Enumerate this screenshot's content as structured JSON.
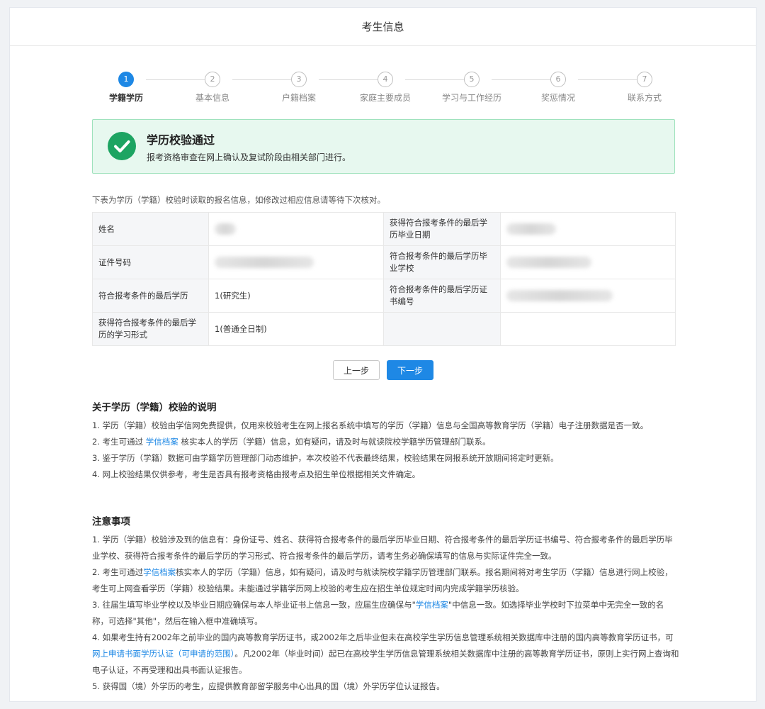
{
  "page": {
    "title": "考生信息"
  },
  "steps": [
    {
      "num": "1",
      "label": "学籍学历"
    },
    {
      "num": "2",
      "label": "基本信息"
    },
    {
      "num": "3",
      "label": "户籍档案"
    },
    {
      "num": "4",
      "label": "家庭主要成员"
    },
    {
      "num": "5",
      "label": "学习与工作经历"
    },
    {
      "num": "6",
      "label": "奖惩情况"
    },
    {
      "num": "7",
      "label": "联系方式"
    }
  ],
  "alert": {
    "title": "学历校验通过",
    "subtitle": "报考资格审查在网上确认及复试阶段由相关部门进行。"
  },
  "intro": "下表为学历（学籍）校验时读取的报名信息，如修改过相应信息请等待下次核对。",
  "table": {
    "rows": [
      {
        "l1": "姓名",
        "v1": "",
        "l2": "获得符合报考条件的最后学历毕业日期",
        "v2": ""
      },
      {
        "l1": "证件号码",
        "v1": "",
        "l2": "符合报考条件的最后学历毕业学校",
        "v2": ""
      },
      {
        "l1": "符合报考条件的最后学历",
        "v1": "1(研究生)",
        "l2": "符合报考条件的最后学历证书编号",
        "v2": ""
      },
      {
        "l1": "获得符合报考条件的最后学历的学习形式",
        "v1": "1(普通全日制)",
        "l2": "",
        "v2": ""
      }
    ]
  },
  "buttons": {
    "prev": "上一步",
    "next": "下一步"
  },
  "about": {
    "title": "关于学历（学籍）校验的说明",
    "p1": "1. 学历（学籍）校验由学信网免费提供，仅用来校验考生在网上报名系统中填写的学历（学籍）信息与全国高等教育学历（学籍）电子注册数据是否一致。",
    "p2_a": "2. 考生可通过 ",
    "p2_link": "学信档案",
    "p2_b": " 核实本人的学历（学籍）信息，如有疑问，请及时与就读院校学籍学历管理部门联系。",
    "p3": "3. 鉴于学历（学籍）数据可由学籍学历管理部门动态维护，本次校验不代表最终结果，校验结果在网报系统开放期间将定时更新。",
    "p4": "4. 网上校验结果仅供参考，考生是否具有报考资格由报考点及招生单位根据相关文件确定。"
  },
  "notes": {
    "title": "注意事项",
    "p1": "1. 学历（学籍）校验涉及到的信息有：身份证号、姓名、获得符合报考条件的最后学历毕业日期、符合报考条件的最后学历证书编号、符合报考条件的最后学历毕业学校、获得符合报考条件的最后学历的学习形式、符合报考条件的最后学历，请考生务必确保填写的信息与实际证件完全一致。",
    "p2_a": "2. 考生可通过",
    "p2_link": "学信档案",
    "p2_b": "核实本人的学历（学籍）信息，如有疑问，请及时与就读院校学籍学历管理部门联系。报名期间将对考生学历（学籍）信息进行网上校验，考生可上网查看学历（学籍）校验结果。未能通过学籍学历网上校验的考生应在招生单位规定时间内完成学籍学历核验。",
    "p3_a": "3. 往届生填写毕业学校以及毕业日期应确保与本人毕业证书上信息一致，应届生应确保与\"",
    "p3_link": "学信档案",
    "p3_b": "\"中信息一致。如选择毕业学校时下拉菜单中无完全一致的名称，可选择\"其他\"，然后在输入框中准确填写。",
    "p4_a": "4. 如果考生持有2002年之前毕业的国内高等教育学历证书，或2002年之后毕业但未在高校学生学历信息管理系统相关数据库中注册的国内高等教育学历证书，可",
    "p4_link1": "网上申请书面学历认证",
    "p4_link2": "（可申请的范围）",
    "p4_b": "。凡2002年（毕业时间）起已在高校学生学历信息管理系统相关数据库中注册的高等教育学历证书，原则上实行网上查询和电子认证，不再受理和出具书面认证报告。",
    "p5": "5. 获得国（境）外学历的考生，应提供教育部留学服务中心出具的国（境）外学历学位认证报告。"
  }
}
